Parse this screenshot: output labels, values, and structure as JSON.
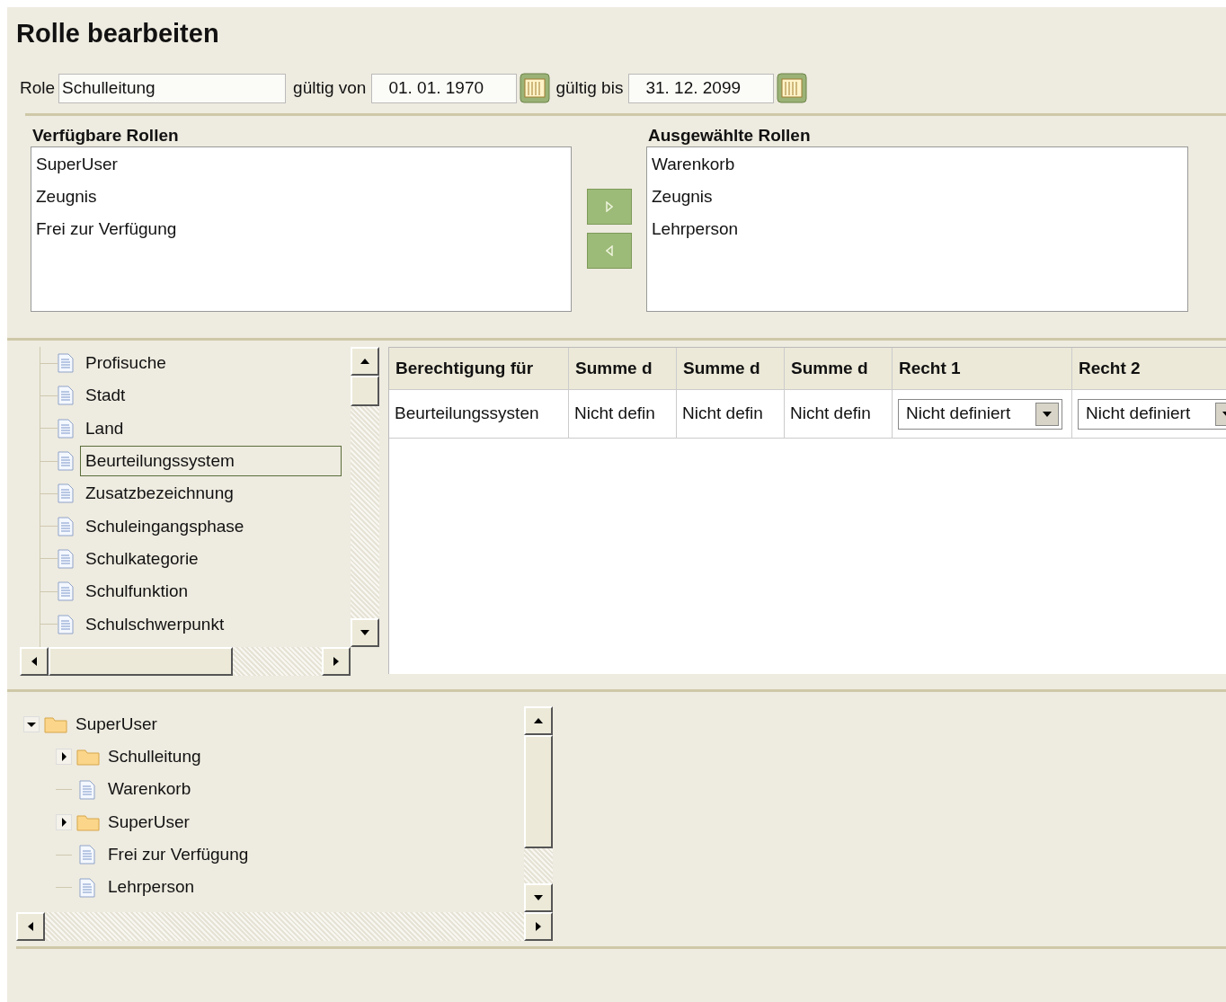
{
  "title": "Rolle bearbeiten",
  "role_row": {
    "role_label": "Role",
    "role_value": "Schulleitung",
    "from_label": "gültig von",
    "from_value": "01. 01. 1970",
    "to_label": "gültig bis",
    "to_value": "31. 12. 2099"
  },
  "available_roles": {
    "heading": "Verfügbare Rollen",
    "items": [
      "SuperUser",
      "Zeugnis",
      "Frei zur Verfügung"
    ]
  },
  "transfer_buttons": [
    {
      "kind": "add"
    },
    {
      "kind": "remove"
    }
  ],
  "selected_roles": {
    "heading": "Ausgewählte Rollen",
    "items": [
      "Warenkorb",
      "Zeugnis",
      "Lehrperson"
    ]
  },
  "permission_tree": {
    "items": [
      {
        "label": "Profisuche",
        "selected": false
      },
      {
        "label": "Stadt",
        "selected": false
      },
      {
        "label": "Land",
        "selected": false
      },
      {
        "label": "Beurteilungssystem",
        "selected": true
      },
      {
        "label": "Zusatzbezeichnung",
        "selected": false
      },
      {
        "label": "Schuleingangsphase",
        "selected": false
      },
      {
        "label": "Schulkategorie",
        "selected": false
      },
      {
        "label": "Schulfunktion",
        "selected": false
      },
      {
        "label": "Schulschwerpunkt",
        "selected": false
      }
    ]
  },
  "permissions_table": {
    "columns": [
      "Berechtigung für",
      "Summe d",
      "Summe d",
      "Summe d",
      "Recht 1",
      "Recht 2"
    ],
    "rows": [
      {
        "cells": [
          {
            "kind": "text",
            "value": "Beurteilungssysten"
          },
          {
            "kind": "text",
            "value": "Nicht defin"
          },
          {
            "kind": "text",
            "value": "Nicht defin"
          },
          {
            "kind": "text",
            "value": "Nicht defin"
          },
          {
            "kind": "dropdown",
            "value": "Nicht definiert"
          },
          {
            "kind": "dropdown",
            "value": "Nicht definiert"
          }
        ]
      }
    ]
  },
  "role_tree": {
    "items": [
      {
        "label": "SuperUser",
        "kind": "folder",
        "expanded": true,
        "children": [
          {
            "label": "Schulleitung",
            "kind": "folder",
            "expanded": false
          },
          {
            "label": "Warenkorb",
            "kind": "document"
          },
          {
            "label": "SuperUser",
            "kind": "folder",
            "expanded": false
          },
          {
            "label": "Frei zur Verfügung",
            "kind": "document"
          },
          {
            "label": "Lehrperson",
            "kind": "document"
          }
        ]
      }
    ]
  }
}
